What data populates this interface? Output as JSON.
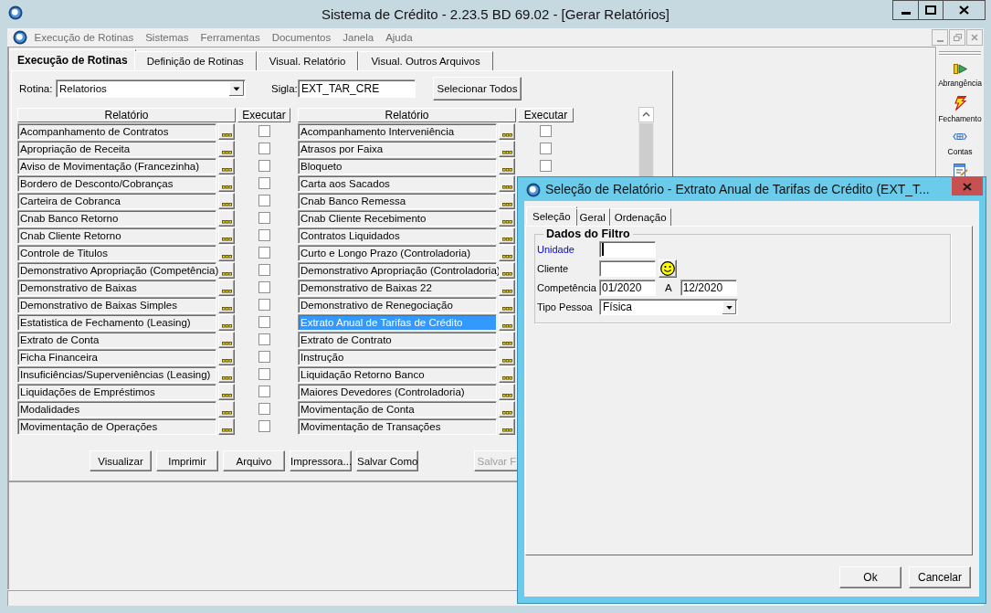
{
  "window": {
    "title": "Sistema de Crédito - 2.23.5 BD 69.02 - [Gerar Relatórios]"
  },
  "menu": [
    {
      "label": "Execução de Rotinas",
      "disabled": true
    },
    {
      "label": "Sistemas",
      "disabled": true
    },
    {
      "label": "Ferramentas",
      "disabled": true
    },
    {
      "label": "Documentos",
      "disabled": true
    },
    {
      "label": "Janela",
      "disabled": true
    },
    {
      "label": "Ajuda",
      "disabled": true
    }
  ],
  "toolbar": [
    {
      "label": "Abrangência"
    },
    {
      "label": "Fechamento"
    },
    {
      "label": "Contas"
    }
  ],
  "tabs": [
    {
      "label": "Execução de Rotinas",
      "selected": true
    },
    {
      "label": "Definição de Rotinas",
      "selected": false
    },
    {
      "label": "Visual. Relatório",
      "selected": false
    },
    {
      "label": "Visual. Outros Arquivos",
      "selected": false
    }
  ],
  "routine": {
    "label": "Rotina:",
    "value": "Relatorios"
  },
  "code": {
    "label": "Sigla:",
    "value": "EXT_TAR_CRE"
  },
  "select_all_button": "Selecionar Todos",
  "report_lists": [
    {
      "columns": [
        "Relatório",
        "Executar"
      ],
      "rows": [
        {
          "name": "Acompanhamento de Contratos",
          "selected": false,
          "checked": false
        },
        {
          "name": "Apropriação de Receita",
          "selected": false,
          "checked": false
        },
        {
          "name": "Aviso de Movimentação (Francezinha)",
          "selected": false,
          "checked": false
        },
        {
          "name": "Bordero de Desconto/Cobranças",
          "selected": false,
          "checked": false
        },
        {
          "name": "Carteira de Cobranca",
          "selected": false,
          "checked": false
        },
        {
          "name": "Cnab Banco Retorno",
          "selected": false,
          "checked": false
        },
        {
          "name": "Cnab Cliente Retorno",
          "selected": false,
          "checked": false
        },
        {
          "name": "Controle de Titulos",
          "selected": false,
          "checked": false
        },
        {
          "name": "Demonstrativo Apropriação (Competência)",
          "selected": false,
          "checked": false
        },
        {
          "name": "Demonstrativo de Baixas",
          "selected": false,
          "checked": false
        },
        {
          "name": "Demonstrativo de Baixas Simples",
          "selected": false,
          "checked": false
        },
        {
          "name": "Estatistica de Fechamento (Leasing)",
          "selected": false,
          "checked": false
        },
        {
          "name": "Extrato de Conta",
          "selected": false,
          "checked": false
        },
        {
          "name": "Ficha Financeira",
          "selected": false,
          "checked": false
        },
        {
          "name": "Insuficiências/Superveniências (Leasing)",
          "selected": false,
          "checked": false
        },
        {
          "name": "Liquidações de Empréstimos",
          "selected": false,
          "checked": false
        },
        {
          "name": "Modalidades",
          "selected": false,
          "checked": false
        },
        {
          "name": "Movimentação de Operações",
          "selected": false,
          "checked": false
        }
      ]
    },
    {
      "columns": [
        "Relatório",
        "Executar"
      ],
      "rows": [
        {
          "name": "Acompanhamento Interveniência",
          "selected": false,
          "checked": false
        },
        {
          "name": "Atrasos por Faixa",
          "selected": false,
          "checked": false
        },
        {
          "name": "Bloqueto",
          "selected": false,
          "checked": false
        },
        {
          "name": "Carta aos Sacados",
          "selected": false
        },
        {
          "name": "Cnab Banco Remessa",
          "selected": false
        },
        {
          "name": "Cnab Cliente Recebimento",
          "selected": false
        },
        {
          "name": "Contratos Liquidados",
          "selected": false
        },
        {
          "name": "Curto e Longo Prazo (Controladoria)",
          "selected": false
        },
        {
          "name": "Demonstrativo Apropriação (Controladoria)",
          "selected": false
        },
        {
          "name": "Demonstrativo de Baixas 22",
          "selected": false
        },
        {
          "name": "Demonstrativo de Renegociação",
          "selected": false
        },
        {
          "name": "Extrato Anual de Tarifas de Crédito",
          "selected": true
        },
        {
          "name": "Extrato de Contrato",
          "selected": false
        },
        {
          "name": "Instrução",
          "selected": false
        },
        {
          "name": "Liquidação Retorno Banco",
          "selected": false
        },
        {
          "name": "Maiores Devedores (Controladoria)",
          "selected": false
        },
        {
          "name": "Movimentação de Conta",
          "selected": false
        },
        {
          "name": "Movimentação de Transações",
          "selected": false
        }
      ]
    }
  ],
  "actions": [
    {
      "label": "Visualizar",
      "disabled": false
    },
    {
      "label": "Imprimir",
      "disabled": false
    },
    {
      "label": "Arquivo",
      "disabled": false
    },
    {
      "label": "Impressora...",
      "disabled": false
    },
    {
      "label": "Salvar Como",
      "disabled": false
    },
    {
      "label": "Salvar F",
      "disabled": true
    }
  ],
  "dialog": {
    "title": "Seleção de Relatório - Extrato Anual de Tarifas de Crédito (EXT_T...",
    "tabs": [
      {
        "label": "Seleção",
        "selected": true
      },
      {
        "label": "Geral",
        "selected": false
      },
      {
        "label": "Ordenação",
        "selected": false
      }
    ],
    "group": {
      "title": "Dados do Filtro",
      "fields": [
        {
          "kind": "text",
          "label": "Unidade",
          "required": true,
          "focused": true
        },
        {
          "kind": "lookup",
          "label": "Cliente",
          "required": false,
          "focused": false
        },
        {
          "kind": "range",
          "label": "Competência",
          "required": false,
          "focused": false,
          "value": "01/2020",
          "separator": "A",
          "value_to": "12/2020"
        },
        {
          "kind": "select",
          "label": "Tipo Pessoa",
          "required": false,
          "focused": false,
          "value": "Física"
        }
      ]
    },
    "buttons": [
      "Ok",
      "Cancelar"
    ]
  }
}
